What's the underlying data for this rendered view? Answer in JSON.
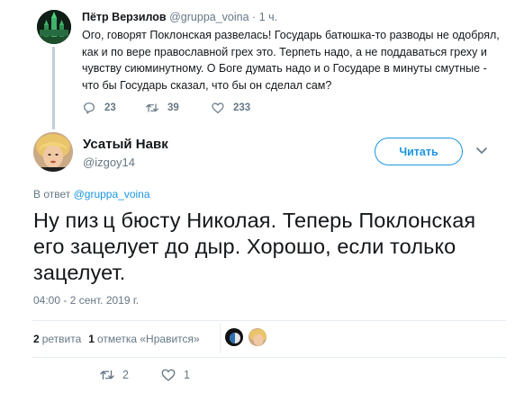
{
  "parent_tweet": {
    "name": "Пётр Верзилов",
    "handle": "@gruppa_voina",
    "separator": "·",
    "time": "1 ч.",
    "text": "Ого, говорят Поклонская развелась! Государь батюшка-то разводы не одобрял, как и по вере православной грех это. Терпеть надо, а не поддаваться греху и чувству сиюминутному. О Боге думать надо и о Государе в минуты смутные - что бы Государь сказал, что бы он сделал сам?",
    "replies": "23",
    "retweets": "39",
    "likes": "233"
  },
  "tweet": {
    "author_name": "Усатый Навк",
    "author_handle": "@izgoy14",
    "follow_label": "Читать",
    "reply_prefix": "В ответ",
    "reply_mention": "@gruppa_voina",
    "text": "Ну пиз ц бюсту Николая. Теперь Поклонская его зацелует до дыр. Хорошо, если только зацелует.",
    "timestamp": "04:00 - 2 сент. 2019 г.",
    "retweet_count": "2",
    "retweet_label": "ретвита",
    "like_count": "1",
    "like_label": "отметка «Нравится»",
    "replies": "",
    "retweets": "2",
    "likes": "1"
  },
  "icons": {
    "reply": "reply-icon",
    "retweet": "retweet-icon",
    "like": "heart-icon",
    "caret": "chevron-down-icon"
  },
  "colors": {
    "accent": "#1b95e0",
    "muted": "#657786",
    "text": "#14171a",
    "divider": "#e6ecf0",
    "thread_line": "#c4cfd6"
  }
}
